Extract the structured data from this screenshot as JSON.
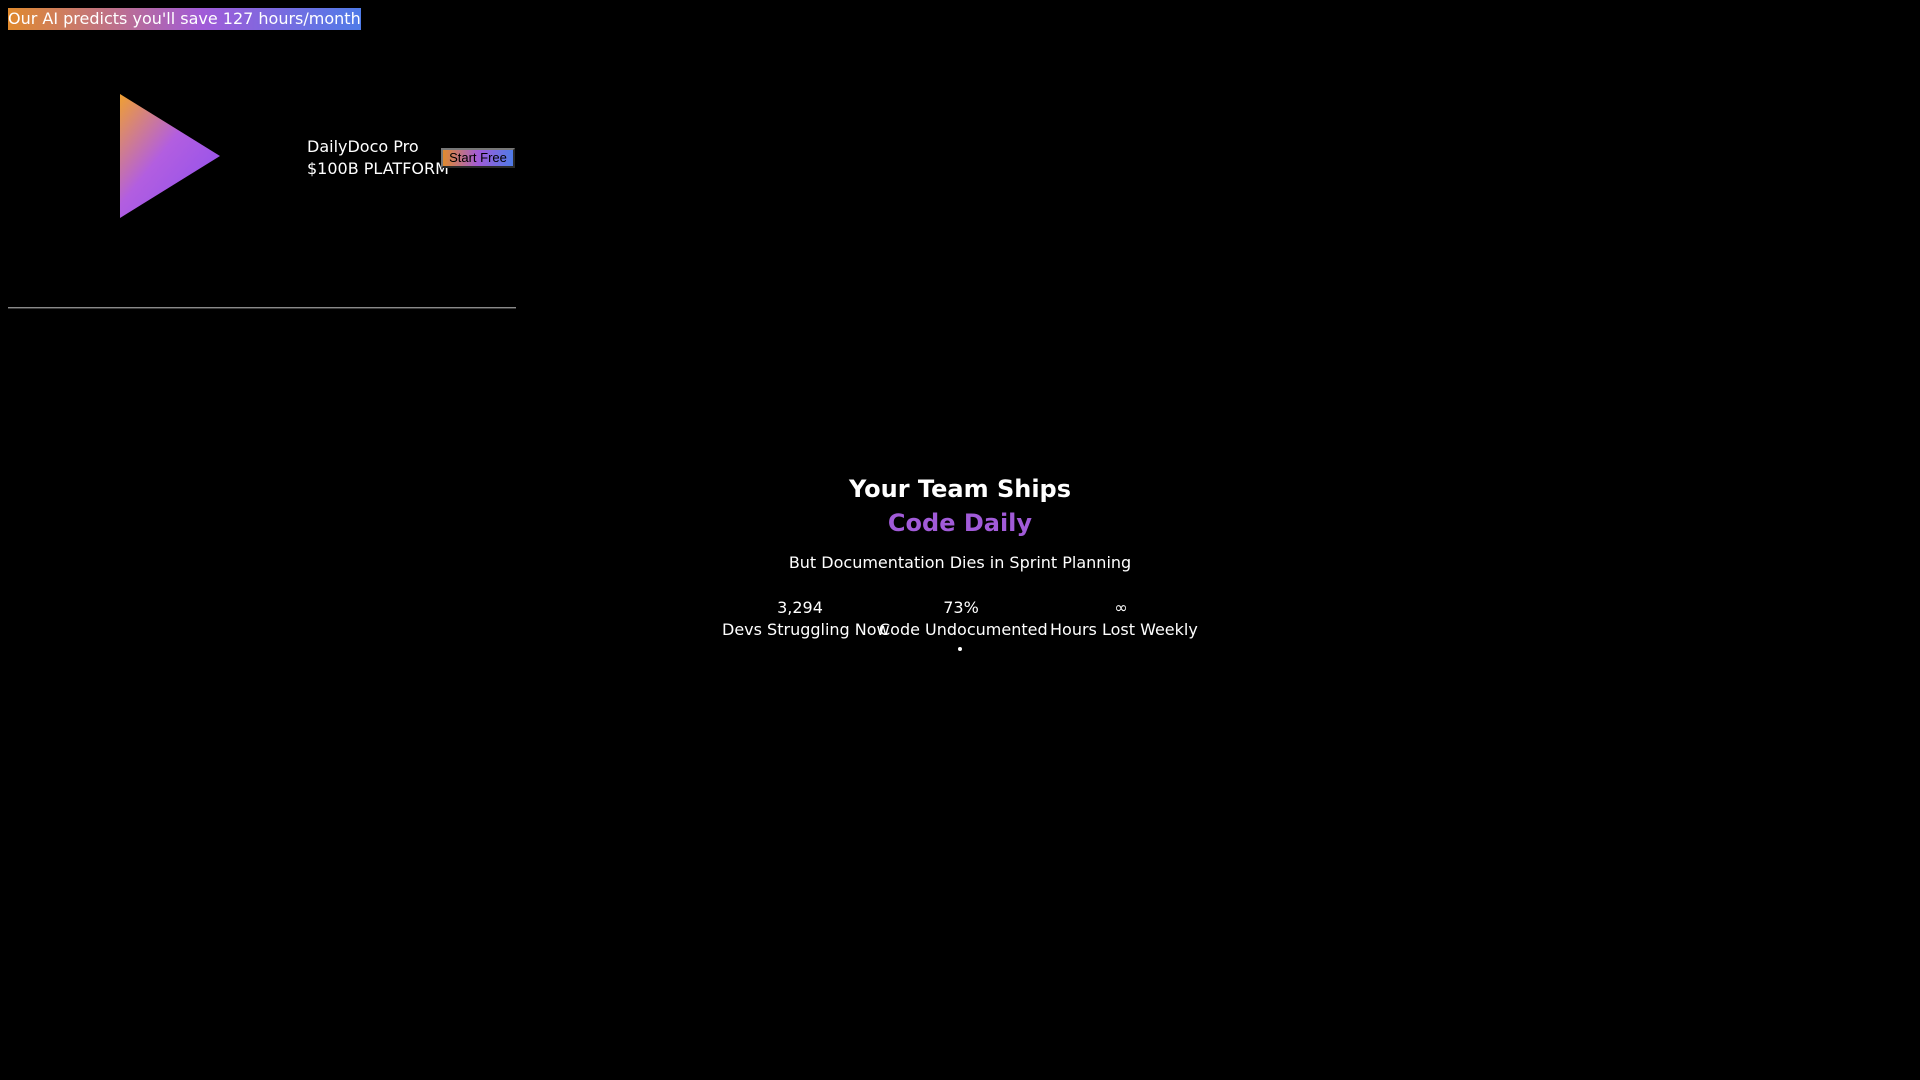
{
  "banner": {
    "text": "Our AI predicts you'll save 127 hours/month"
  },
  "header": {
    "logo_icon": "play-triangle-icon",
    "brand_name": "DailyDoco Pro",
    "brand_tagline": "$100B PLATFORM",
    "cta_label": "Start Free"
  },
  "hero": {
    "line1": "Your Team Ships",
    "line2": "Code Daily",
    "subtitle": "But Documentation Dies in Sprint Planning"
  },
  "stats": [
    {
      "value": "3,294",
      "label": "Devs Struggling Now"
    },
    {
      "value": "73%",
      "label": "Code Undocumented"
    },
    {
      "value": "∞",
      "label": "Hours Lost Weekly"
    }
  ],
  "colors": {
    "background": "#000000",
    "text": "#ffffff",
    "accent_purple": "#a15bd8",
    "gradient_orange": "#e08a2e",
    "gradient_blue": "#4f7be8"
  }
}
